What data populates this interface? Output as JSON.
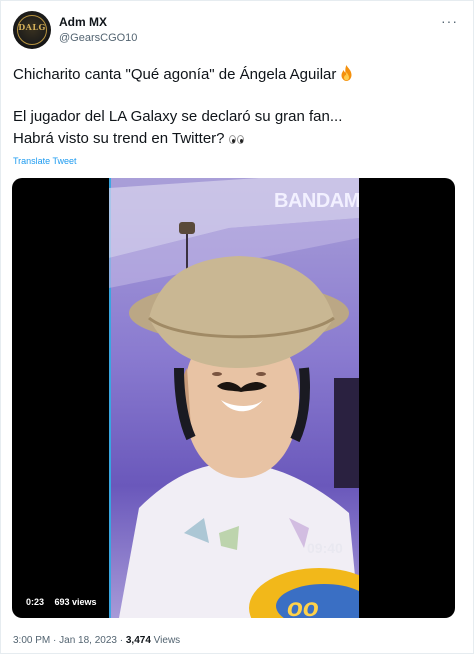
{
  "tweet": {
    "avatar_text": "DALG",
    "display_name": "Adm MX",
    "handle": "@GearsCGO10",
    "more": "···",
    "line1": "Chicharito canta \"Qué agonía\" de Ángela Aguilar",
    "line2": "El jugador del LA Galaxy se declaró su gran fan...",
    "line3": "Habrá visto su trend en Twitter?",
    "translate": "Translate Tweet"
  },
  "video": {
    "overlay_brand": "BANDAM",
    "overlay_time": "09:40",
    "duration": "0:23",
    "views": "693 views"
  },
  "footer": {
    "time_date": "3:00 PM · Jan 18, 2023 ·",
    "views_count": "3,474",
    "views_label": "Views"
  },
  "icons": {
    "fire": "fire-emoji-icon",
    "eyes": "eyes-emoji-icon",
    "more": "more-dots-icon"
  }
}
